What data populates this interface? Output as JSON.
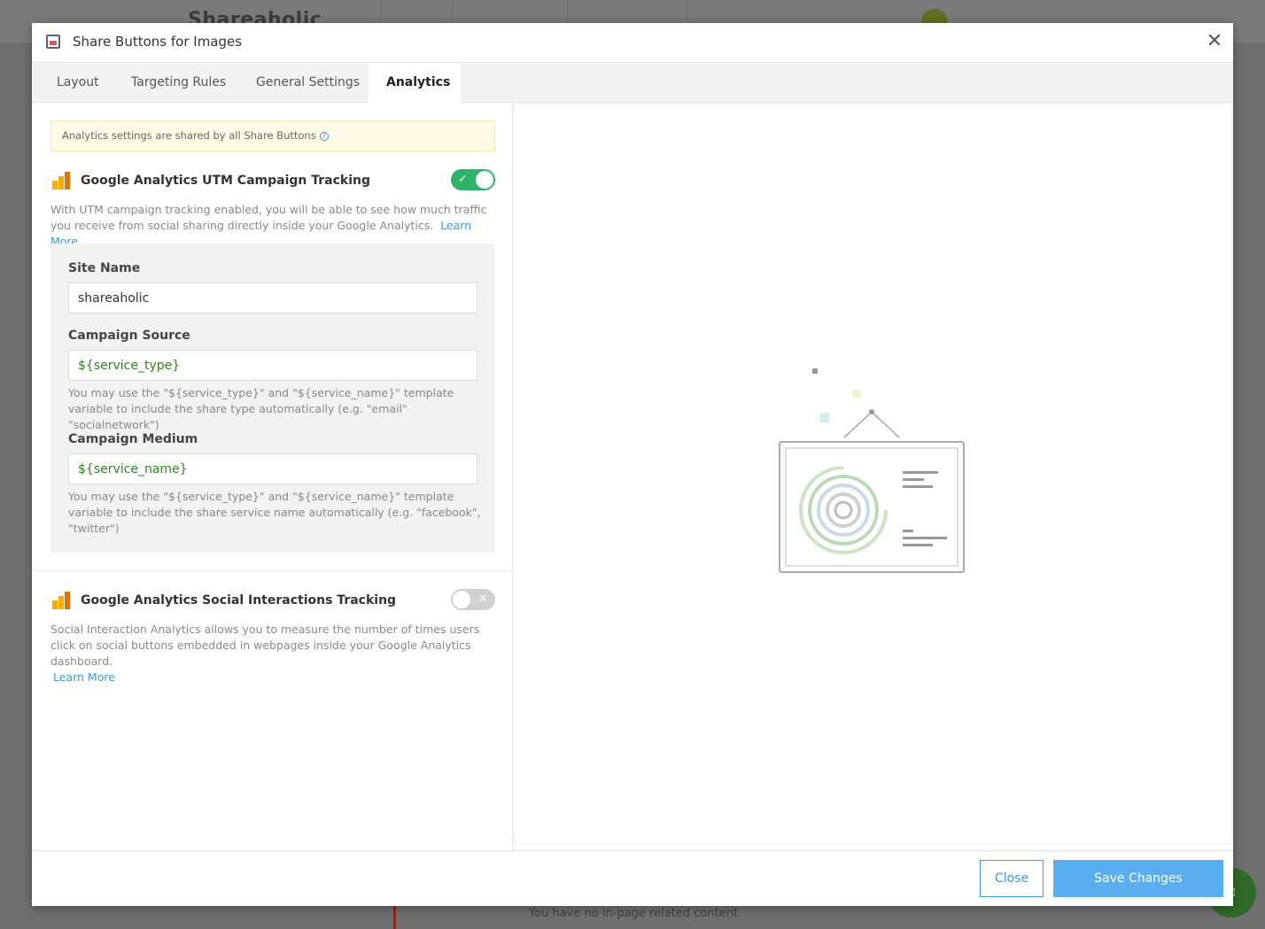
{
  "background": {
    "logo_text": "Shareaholic",
    "footer_text": "You have no in-page related content"
  },
  "modal": {
    "title": "Share Buttons for Images",
    "close_icon": "close-icon",
    "tabs": [
      {
        "label": "Layout",
        "active": false
      },
      {
        "label": "Targeting Rules",
        "active": false
      },
      {
        "label": "General Settings",
        "active": false
      },
      {
        "label": "Analytics",
        "active": true
      }
    ]
  },
  "analytics": {
    "notice": "Analytics settings are shared by all Share Buttons",
    "utm": {
      "title": "Google Analytics UTM Campaign Tracking",
      "enabled": true,
      "description": "With UTM campaign tracking enabled, you will be able to see how much traffic you receive from social sharing directly inside your Google Analytics.",
      "learn_more": "Learn More",
      "site_name_label": "Site Name",
      "site_name_value": "shareaholic",
      "campaign_source_label": "Campaign Source",
      "campaign_source_value": "${service_type}",
      "campaign_source_help": "You may use the \"${service_type}\" and \"${service_name}\" template variable to include the share type automatically (e.g. \"email\" \"socialnetwork\")",
      "campaign_medium_label": "Campaign Medium",
      "campaign_medium_value": "${service_name}",
      "campaign_medium_help": "You may use the \"${service_type}\" and \"${service_name}\" template variable to include the share service name automatically (e.g. \"facebook\", \"twitter\")"
    },
    "social": {
      "title": "Google Analytics Social Interactions Tracking",
      "enabled": false,
      "description": "Social Interaction Analytics allows you to measure the number of times users click on social buttons embedded in webpages inside your Google Analytics dashboard.",
      "learn_more": "Learn More"
    }
  },
  "footer": {
    "close_label": "Close",
    "save_label": "Save Changes"
  },
  "colors": {
    "toggle_on": "#2eb369",
    "toggle_off": "#d0d0d0",
    "link": "#3b9bd8",
    "save_button": "#5aaef0"
  }
}
